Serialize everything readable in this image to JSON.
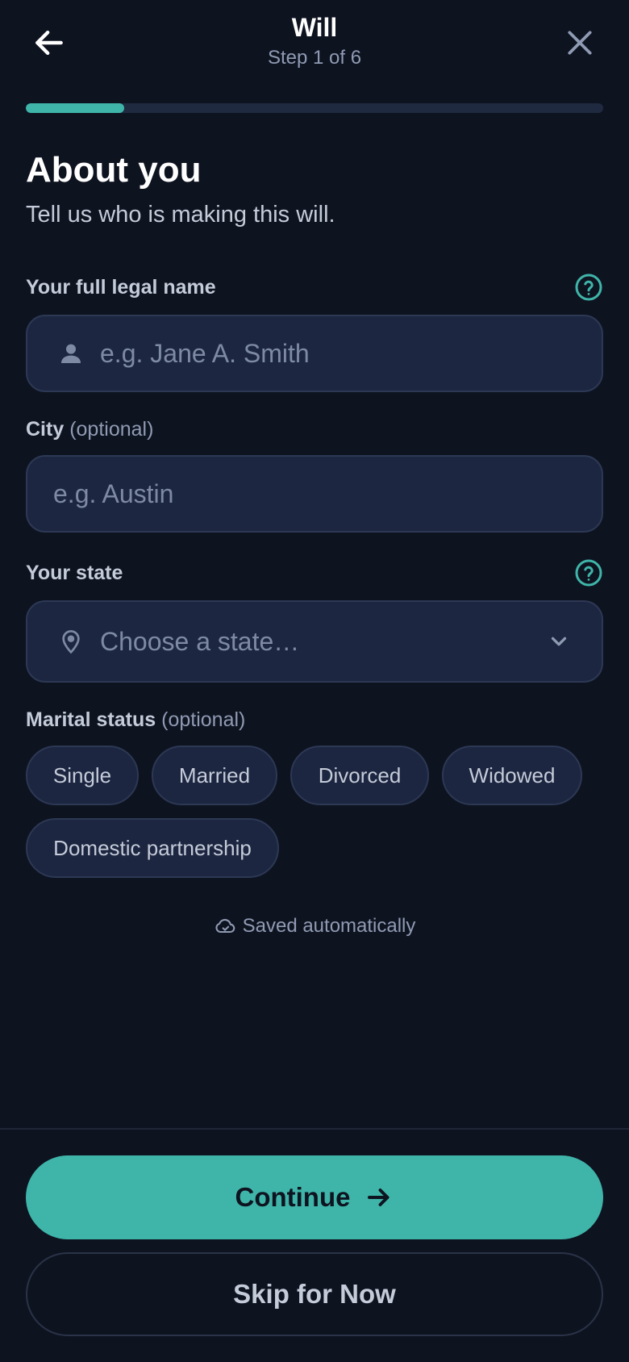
{
  "header": {
    "back_icon": "arrow-left-icon",
    "title": "Will",
    "step": "Step 1 of 6",
    "close_icon": "close-icon"
  },
  "progress": {
    "current_step": 1,
    "total_steps": 6,
    "fraction": 0.17,
    "color": "#3fb5a9"
  },
  "section": {
    "heading": "About you",
    "description": "Tell us who is making this will."
  },
  "fields": {
    "name": {
      "label": "Your full legal name",
      "placeholder": "e.g. Jane A. Smith",
      "value": "",
      "icon": "person-icon",
      "help_icon": "help-circle-icon"
    },
    "city": {
      "label": "City",
      "optional": "(optional)",
      "placeholder": "e.g. Austin",
      "value": ""
    },
    "state": {
      "label": "Your state",
      "placeholder": "Choose a state…",
      "icon": "map-pin-icon",
      "chevron": "chevron-down-icon",
      "help_icon": "help-circle-icon"
    },
    "marital": {
      "label": "Marital status",
      "optional": "(optional)",
      "options": [
        "Single",
        "Married",
        "Divorced",
        "Widowed",
        "Domestic partnership"
      ]
    }
  },
  "saved_status": {
    "text": "Saved automatically",
    "icon": "cloud-check-icon"
  },
  "actions": {
    "continue_label": "Continue",
    "continue_icon": "arrow-right-icon",
    "skip_label": "Skip for Now"
  },
  "colors": {
    "background": "#0e1320",
    "accent": "#3fb5a9",
    "field_bg": "#1c2640",
    "muted_text": "#8f9bb3"
  }
}
